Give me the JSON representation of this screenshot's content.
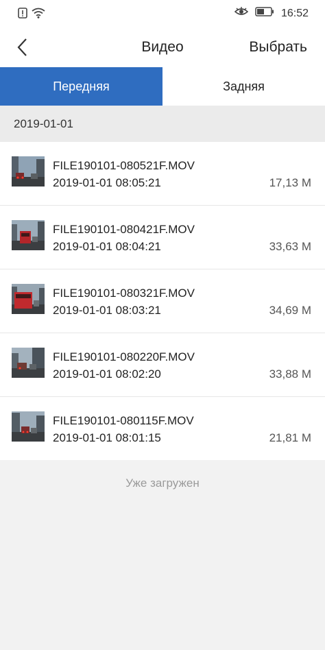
{
  "status_bar": {
    "time": "16:52",
    "icons": [
      "alert-icon",
      "wifi-icon",
      "eye-icon",
      "battery-icon"
    ]
  },
  "nav": {
    "title": "Видео",
    "select_label": "Выбрать",
    "back_icon": "chevron-left-icon"
  },
  "tabs": [
    {
      "label": "Передняя",
      "active": true
    },
    {
      "label": "Задняя",
      "active": false
    }
  ],
  "group": {
    "date": "2019-01-01"
  },
  "files": [
    {
      "name": "FILE190101-080521F.MOV",
      "datetime": "2019-01-01 08:05:21",
      "size": "17,13 M"
    },
    {
      "name": "FILE190101-080421F.MOV",
      "datetime": "2019-01-01 08:04:21",
      "size": "33,63 M"
    },
    {
      "name": "FILE190101-080321F.MOV",
      "datetime": "2019-01-01 08:03:21",
      "size": "34,69 M"
    },
    {
      "name": "FILE190101-080220F.MOV",
      "datetime": "2019-01-01 08:02:20",
      "size": "33,88 M"
    },
    {
      "name": "FILE190101-080115F.MOV",
      "datetime": "2019-01-01 08:01:15",
      "size": "21,81 M"
    }
  ],
  "footer": {
    "loaded_text": "Уже загружен"
  },
  "colors": {
    "accent": "#2f6dc0",
    "background": "#f2f2f2"
  }
}
